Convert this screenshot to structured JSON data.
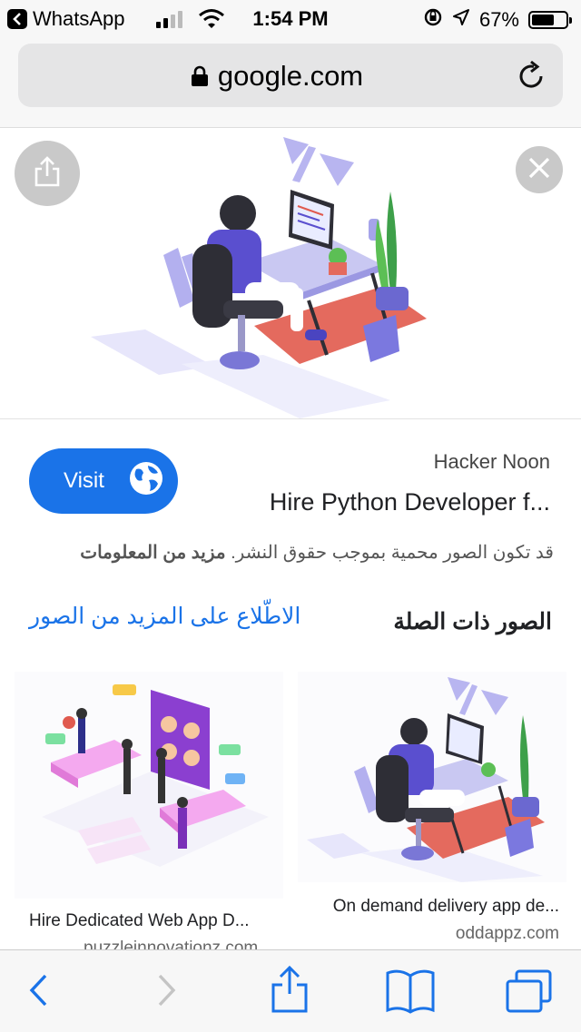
{
  "status_bar": {
    "back_app": "WhatsApp",
    "time": "1:54 PM",
    "battery": "67%",
    "battery_level": 0.67
  },
  "url_bar": {
    "domain": "google.com"
  },
  "result": {
    "visit_label": "Visit",
    "source": "Hacker Noon",
    "title": "Hire Python Developer f...",
    "rights_text": "قد تكون الصور محمية بموجب حقوق النشر.",
    "rights_link": "مزيد من المعلومات"
  },
  "related": {
    "title": "الصور ذات الصلة",
    "see_more": "الاطّلاع على المزيد من الصور",
    "items": [
      {
        "title": "Hire Dedicated Web App D...",
        "site": "puzzleinnovationz.com"
      },
      {
        "title": "On demand delivery app de...",
        "site": "oddappz.com"
      }
    ]
  },
  "colors": {
    "accent": "#1a73e8",
    "illustration_purple": "#5a4fcf",
    "illustration_red": "#e05a4f"
  },
  "icons": {
    "share": "share-icon",
    "close": "close-icon",
    "globe": "globe-icon",
    "lock": "lock-icon",
    "reload": "reload-icon",
    "back": "chevron-left-icon",
    "forward": "chevron-right-icon",
    "bookmarks": "book-icon",
    "tabs": "tabs-icon"
  }
}
